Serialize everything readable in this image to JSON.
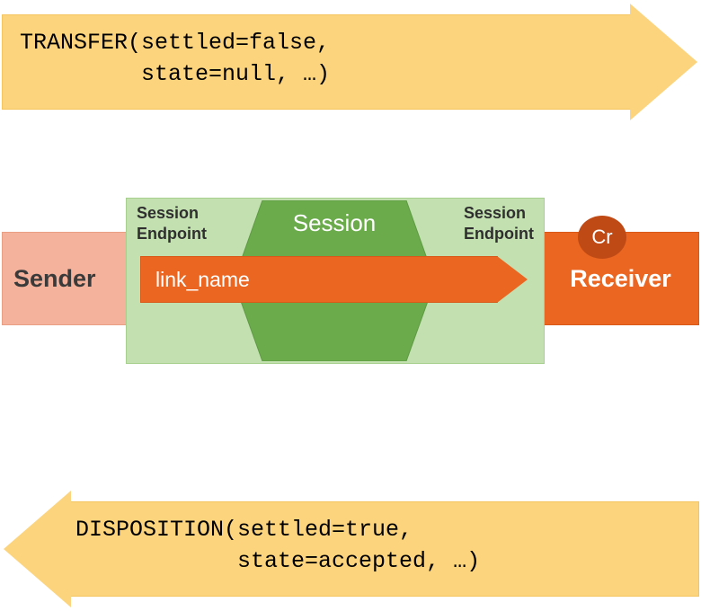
{
  "top_arrow": {
    "line1": "TRANSFER(settled=false,",
    "line2": "         state=null, …)"
  },
  "bottom_arrow": {
    "line1": "DISPOSITION(settled=true,",
    "line2": "            state=accepted, …)"
  },
  "sender": {
    "label": "Sender"
  },
  "receiver": {
    "label": "Receiver"
  },
  "session": {
    "title": "Session",
    "endpoint_left_l1": "Session",
    "endpoint_left_l2": "Endpoint",
    "endpoint_right_l1": "Session",
    "endpoint_right_l2": "Endpoint"
  },
  "link": {
    "name": "link_name"
  },
  "credit_badge": {
    "label": "Cr"
  },
  "colors": {
    "arrow_bg": "#fcd47d",
    "sender_bg": "#f4b29c",
    "receiver_bg": "#ea6621",
    "session_light": "#c3e0b0",
    "session_dark": "#6bab4c",
    "link_bg": "#ea6621",
    "badge_bg": "#c04a15"
  }
}
